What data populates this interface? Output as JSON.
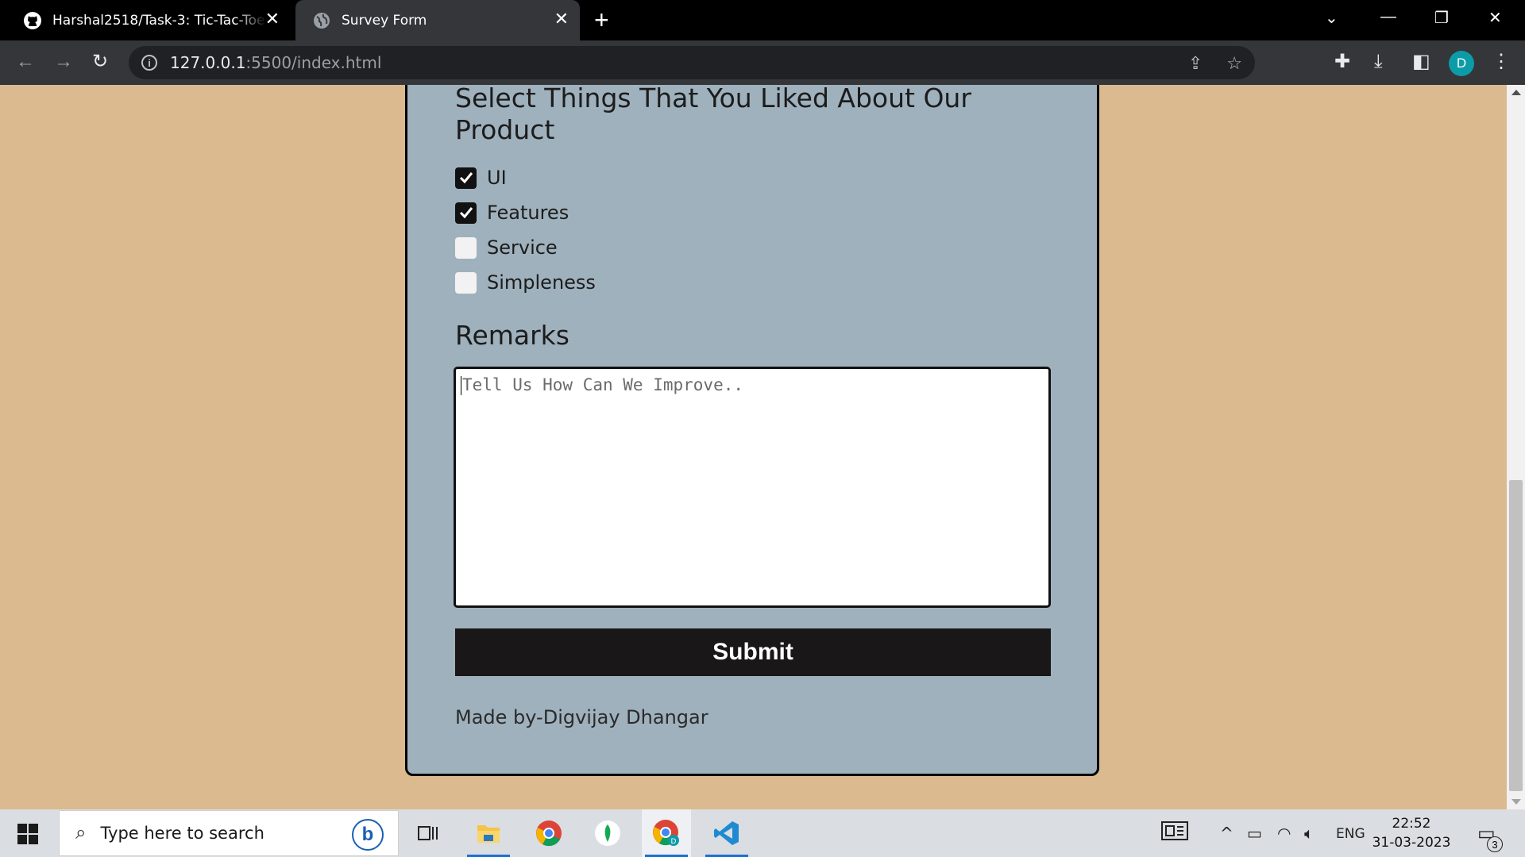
{
  "browser": {
    "tabs": [
      {
        "title": "Harshal2518/Task-3: Tic-Tac-Toe (",
        "icon": "github-icon",
        "active": false
      },
      {
        "title": "Survey Form",
        "icon": "globe-icon",
        "active": true
      }
    ],
    "url_host": "127.0.0.1",
    "url_path": ":5500/index.html",
    "profile_initial": "D"
  },
  "form": {
    "liked_title": "Select Things That You Liked About Our Product",
    "options": [
      {
        "label": "UI",
        "checked": true
      },
      {
        "label": "Features",
        "checked": true
      },
      {
        "label": "Service",
        "checked": false
      },
      {
        "label": "Simpleness",
        "checked": false
      }
    ],
    "remarks_title": "Remarks",
    "remarks_placeholder": "Tell Us How Can We Improve..",
    "submit_label": "Submit",
    "footer": "Made by-Digvijay Dhangar"
  },
  "taskbar": {
    "search_placeholder": "Type here to search",
    "language": "ENG",
    "time": "22:52",
    "date": "31-03-2023",
    "notification_count": "3"
  },
  "colors": {
    "page_bg": "#dbba8f",
    "card_bg": "#9fb1bd",
    "submit_bg": "#1a1718"
  }
}
